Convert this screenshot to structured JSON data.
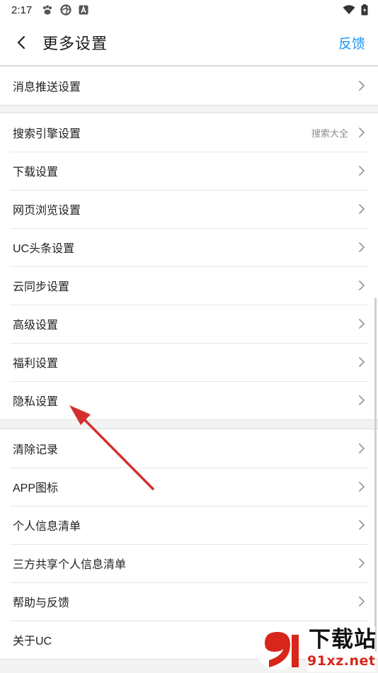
{
  "status_bar": {
    "time": "2:17",
    "left_icons": [
      "paw-icon",
      "aperture-icon",
      "app-a-icon"
    ],
    "right_icons": [
      "wifi-icon",
      "battery-icon"
    ]
  },
  "header": {
    "title": "更多设置",
    "feedback_label": "反馈",
    "accent_color": "#2196f3"
  },
  "groups": [
    {
      "items": [
        {
          "label": "消息推送设置",
          "value": ""
        }
      ]
    },
    {
      "items": [
        {
          "label": "搜索引擎设置",
          "value": "搜索大全"
        },
        {
          "label": "下载设置",
          "value": ""
        },
        {
          "label": "网页浏览设置",
          "value": ""
        },
        {
          "label": "UC头条设置",
          "value": ""
        },
        {
          "label": "云同步设置",
          "value": ""
        },
        {
          "label": "高级设置",
          "value": ""
        },
        {
          "label": "福利设置",
          "value": ""
        },
        {
          "label": "隐私设置",
          "value": ""
        }
      ]
    },
    {
      "items": [
        {
          "label": "清除记录",
          "value": ""
        },
        {
          "label": "APP图标",
          "value": ""
        },
        {
          "label": "个人信息清单",
          "value": ""
        },
        {
          "label": "三方共享个人信息清单",
          "value": ""
        },
        {
          "label": "帮助与反馈",
          "value": ""
        },
        {
          "label": "关于UC",
          "value": ""
        }
      ]
    }
  ],
  "annotation": {
    "color": "#d32f2f",
    "icon": "red-arrow-icon"
  },
  "watermark": {
    "logo_text": "下载站",
    "site": "91xz.net",
    "color": "#d8261a"
  }
}
